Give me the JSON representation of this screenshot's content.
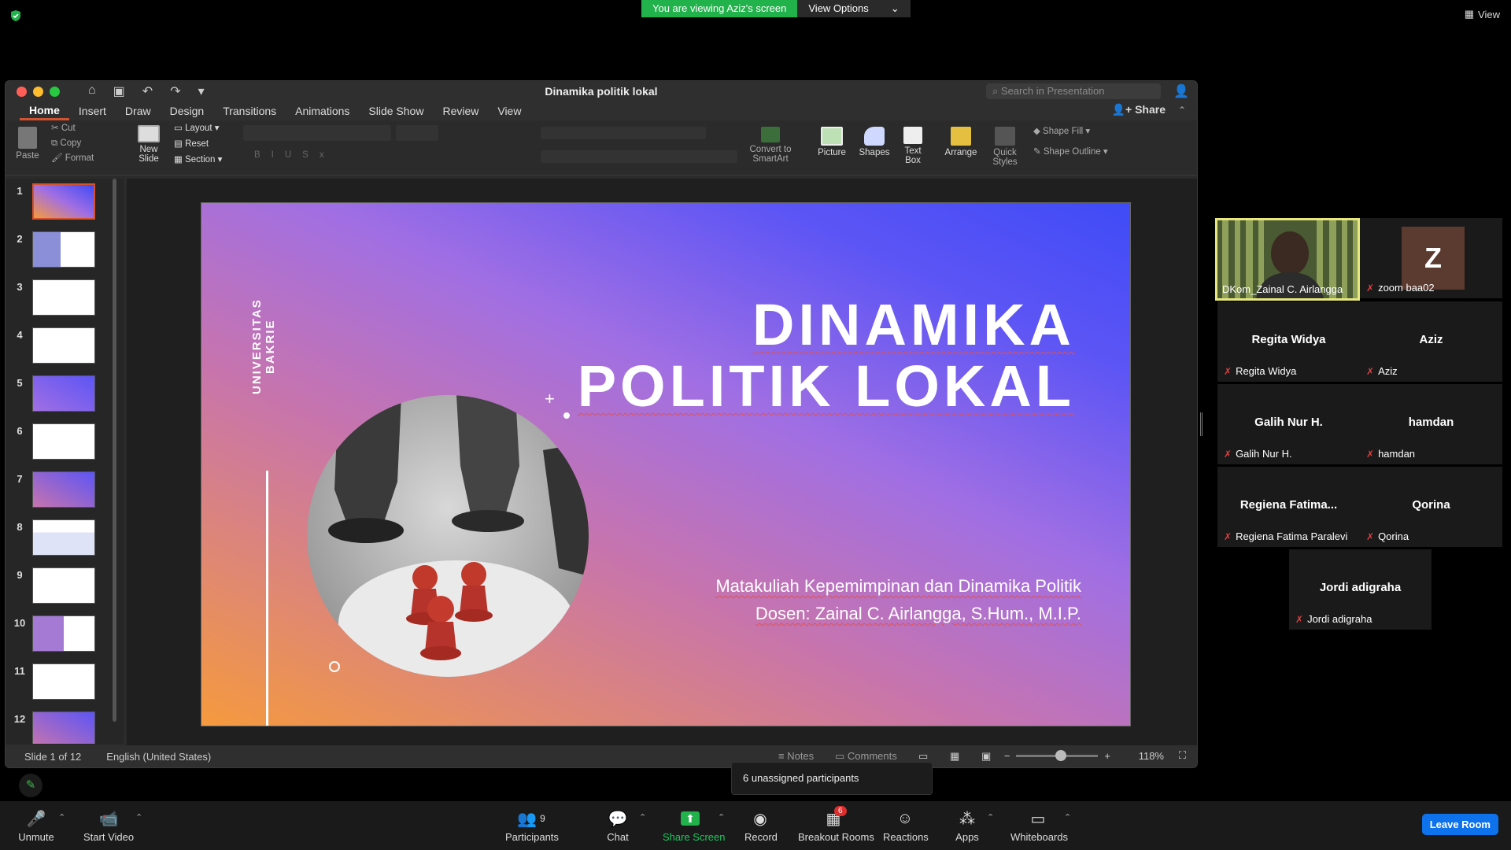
{
  "banner": {
    "message": "You are viewing Aziz's screen",
    "options": "View Options"
  },
  "top_right": {
    "view": "View"
  },
  "ppt": {
    "title": "Dinamika politik lokal",
    "search_placeholder": "Search in Presentation",
    "share": "Share",
    "tabs": [
      "Home",
      "Insert",
      "Draw",
      "Design",
      "Transitions",
      "Animations",
      "Slide Show",
      "Review",
      "View"
    ],
    "active_tab": "Home",
    "ribbon": {
      "paste": "Paste",
      "cut": "Cut",
      "copy": "Copy",
      "format": "Format",
      "new_slide": "New\nSlide",
      "layout": "Layout",
      "reset": "Reset",
      "section": "Section",
      "convert": "Convert to\nSmartArt",
      "picture": "Picture",
      "shapes": "Shapes",
      "text_box": "Text\nBox",
      "arrange": "Arrange",
      "quick_styles": "Quick\nStyles",
      "shape_fill": "Shape Fill",
      "shape_outline": "Shape Outline"
    },
    "thumbnails": [
      "1",
      "2",
      "3",
      "4",
      "5",
      "6",
      "7",
      "8",
      "9",
      "10",
      "11",
      "12"
    ],
    "selected_slide": "1",
    "slide": {
      "university": "UNIVERSITAS BAKRIE",
      "title_line1": "DINAMIKA",
      "title_line2": "POLITIK LOKAL",
      "subtitle1": "Matakuliah Kepemimpinan dan Dinamika Politik",
      "subtitle2": "Dosen: Zainal C. Airlangga, S.Hum., M.I.P."
    },
    "status": {
      "slide_info": "Slide 1 of 12",
      "language": "English (United States)",
      "notes": "Notes",
      "comments": "Comments",
      "zoom": "118%"
    }
  },
  "participants": [
    {
      "caption": "DKom_Zainal C. Airlangga",
      "video": true
    },
    {
      "caption": "zoom baa02",
      "avatar": "Z"
    },
    {
      "name": "Regita Widya",
      "caption": "Regita Widya"
    },
    {
      "name": "Aziz",
      "caption": "Aziz"
    },
    {
      "name": "Galih Nur H.",
      "caption": "Galih Nur H."
    },
    {
      "name": "hamdan",
      "caption": "hamdan"
    },
    {
      "name": "Regiena  Fatima...",
      "caption": "Regiena Fatima Paralevi"
    },
    {
      "name": "Qorina",
      "caption": "Qorina"
    },
    {
      "name": "Jordi adigraha",
      "caption": "Jordi adigraha"
    }
  ],
  "popup": {
    "unassigned": "6 unassigned participants"
  },
  "toolbar": {
    "unmute": "Unmute",
    "start_video": "Start Video",
    "participants": "Participants",
    "participants_count": "9",
    "chat": "Chat",
    "share_screen": "Share Screen",
    "record": "Record",
    "breakout": "Breakout Rooms",
    "breakout_badge": "6",
    "reactions": "Reactions",
    "apps": "Apps",
    "whiteboards": "Whiteboards",
    "leave": "Leave Room"
  },
  "colors": {
    "accent_ppt": "#d35230",
    "zoom_green": "#22b24c",
    "leave_blue": "#0e72ed",
    "muted_red": "#e04040"
  }
}
